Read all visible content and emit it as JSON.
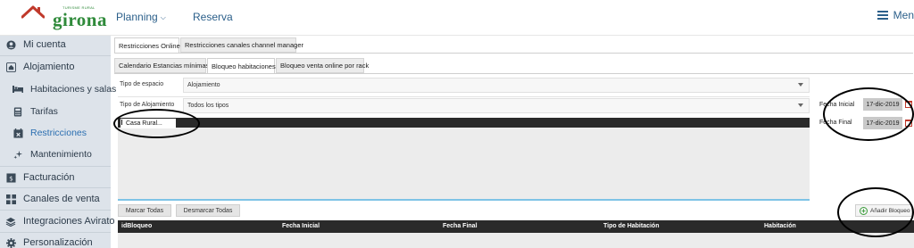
{
  "header": {
    "logo": {
      "brand": "girona",
      "tagline": "TURISME RURAL"
    },
    "nav": [
      {
        "label": "Planning",
        "icon": "chevron-down-icon"
      },
      {
        "label": "Reserva"
      }
    ],
    "menu_label": "Men"
  },
  "sidebar": {
    "items": [
      {
        "label": "Mi cuenta",
        "icon": "user-circle-icon"
      },
      {
        "label": "Alojamiento",
        "icon": "house-icon"
      },
      {
        "label": "Habitaciones y salas",
        "icon": "bed-icon"
      },
      {
        "label": "Tarifas",
        "icon": "calculator-icon"
      },
      {
        "label": "Restricciones",
        "icon": "calendar-x-icon"
      },
      {
        "label": "Mantenimiento",
        "icon": "sparkle-icon"
      },
      {
        "label": "Facturación",
        "icon": "invoice-icon"
      },
      {
        "label": "Canales de venta",
        "icon": "grid-icon"
      },
      {
        "label": "Integraciones Avirato",
        "icon": "layers-icon"
      },
      {
        "label": "Personalización",
        "icon": "gear-icon"
      }
    ]
  },
  "tabs_primary": [
    {
      "label": "Restricciones Online"
    },
    {
      "label": "Restricciones canales channel manager"
    }
  ],
  "tabs_secondary": [
    {
      "label": "Calendario Estancias mínimas"
    },
    {
      "label": "Bloqueo habitaciones"
    },
    {
      "label": "Bloqueo venta online por rack"
    }
  ],
  "form": {
    "tipo_espacio": {
      "label": "Tipo de espacio",
      "value": "Alojamiento"
    },
    "tipo_alojamiento": {
      "label": "Tipo de  Alojamiento",
      "value": "Todos los tipos"
    },
    "tree_node": "Casa Rural...",
    "fecha_inicial": {
      "label": "Fecha Inicial",
      "value": "17-dic-2019"
    },
    "fecha_final": {
      "label": "Fecha Final",
      "value": "17-dic-2019"
    }
  },
  "buttons": {
    "marcar_todas": "Marcar Todas",
    "desmarcar_todas": "Desmarcar Todas",
    "anadir_bloqueo": "Añadir Bloqueo"
  },
  "table": {
    "columns": [
      "idBloqueo",
      "Fecha Inicial",
      "Fecha Final",
      "Tipo de Habitación",
      "Habitación"
    ]
  },
  "colors": {
    "brand_green": "#2f8a3a",
    "nav_blue": "#2b5f8a",
    "sidebar_bg": "#dde3ea",
    "table_header": "#2a2a2a",
    "accent_line": "#7ec3e6"
  }
}
